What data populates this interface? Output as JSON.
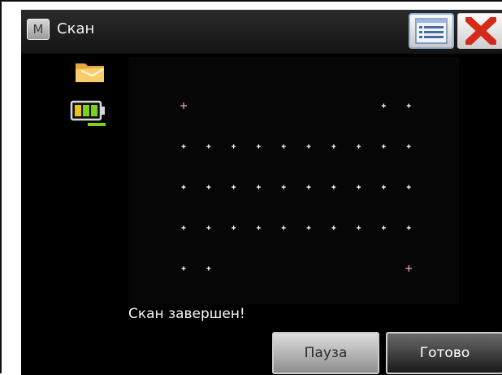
{
  "window": {
    "menu_label": "M",
    "title": "Скан",
    "list_button_icon": "list-icon",
    "close_button_icon": "close-icon",
    "close_color": "#d42a1a"
  },
  "status_icons": {
    "folder_icon": "folder-icon",
    "battery_icon": "battery-icon",
    "battery_color": "#7bd11f"
  },
  "scan": {
    "columns": 10,
    "rows": 5,
    "points": [
      [
        1,
        0,
        0,
        0,
        0,
        0,
        0,
        0,
        1,
        1
      ],
      [
        1,
        1,
        1,
        1,
        1,
        1,
        1,
        1,
        1,
        1
      ],
      [
        1,
        1,
        1,
        1,
        1,
        1,
        1,
        1,
        1,
        1
      ],
      [
        1,
        1,
        1,
        1,
        1,
        1,
        1,
        1,
        1,
        1
      ],
      [
        1,
        1,
        0,
        0,
        0,
        0,
        0,
        0,
        0,
        1
      ]
    ],
    "highlighted_points": [
      [
        0,
        0
      ],
      [
        4,
        9
      ]
    ],
    "point_color": "#ffffff",
    "highlight_color": "#e8a0a0",
    "status": "Скан завершен!"
  },
  "buttons": {
    "pause": "Пауза",
    "done": "Готово"
  }
}
